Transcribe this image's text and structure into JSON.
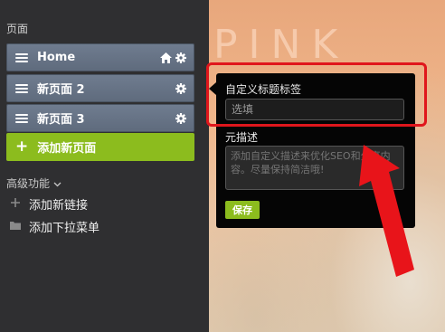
{
  "sidebar": {
    "section_title": "页面",
    "pages": [
      {
        "label": "Home",
        "icons": [
          "home-icon",
          "gear-icon"
        ]
      },
      {
        "label": "新页面 2",
        "icons": [
          "gear-icon"
        ]
      },
      {
        "label": "新页面 3",
        "icons": [
          "gear-icon"
        ]
      }
    ],
    "add_page_label": "添加新页面",
    "advanced_title": "高级功能",
    "advanced_links": [
      {
        "label": "添加新链接",
        "icon": "plus-icon"
      },
      {
        "label": "添加下拉菜单",
        "icon": "folder-icon"
      }
    ]
  },
  "background": {
    "word": "PINK"
  },
  "popup": {
    "title_label": "自定义标题标签",
    "title_placeholder": "选填",
    "desc_label": "元描述",
    "desc_placeholder": "添加自定义描述来优化SEO和分享内容。尽量保持简洁哦!",
    "save_label": "保存"
  },
  "colors": {
    "accent_green": "#8cbc1e",
    "annotation_red": "#e0161c",
    "sidebar_bg": "#2f2f31",
    "page_item": "#667386"
  }
}
